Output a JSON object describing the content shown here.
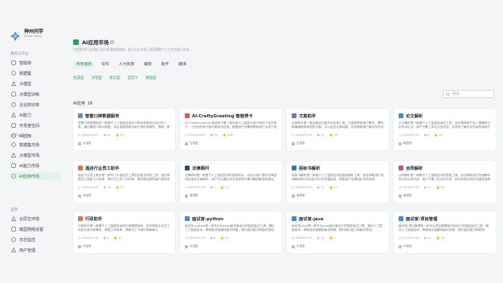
{
  "brand": {
    "name": "神州问学",
    "sub": "Smart Vision"
  },
  "sidebar": {
    "groups": [
      {
        "title": "我的工作台",
        "items": [
          "智能体",
          "数据集",
          "大模型",
          "大模型训练",
          "企业知识库",
          "AI能力",
          "开发者空间",
          "AI应用"
        ]
      },
      {
        "title": "问学AI市场",
        "items": [
          "数据集市场",
          "大模型市场",
          "AI能力市场",
          "AI应用市场"
        ]
      },
      {
        "title": "运营",
        "items": [
          "云原生环境",
          "模型网络设置",
          "日志监控",
          "用户管理"
        ]
      }
    ],
    "active": "AI应用市场"
  },
  "page": {
    "title": "AI应用市场",
    "subtitle": "为您提供行业内热门的AI应用和智能体，助可以从市场上直接提取个人工作台进行应用。",
    "tabs": [
      "所有类别",
      "写作",
      "人力资源",
      "编程",
      "助手",
      "翻译"
    ],
    "active_tab": "所有类别",
    "filters": [
      "生成型",
      "对话型",
      "语言型",
      "自定义",
      "增强型"
    ],
    "section_title": "AI应用",
    "section_count": "16",
    "search_placeholder": "搜索"
  },
  "colors": {
    "accent": "#27a35a"
  },
  "cards": [
    {
      "title": "智慧口岸数据服务",
      "icon_color": "#6c8ebf",
      "desc": "智慧口岸数据服务一款基于人工智能技术的口岸信息服务应用分析工具，通过集成口岸AI数据，该应用能帮助为用户提供准确的、透明、便捷服务。",
      "date": "2024/02/07",
      "views": "22",
      "likes": "10",
      "tag": "对话型"
    },
    {
      "title": "AI-CraftyGreeting 智能贺卡",
      "icon_color": "#e05555",
      "desc": "AI-CraftyGreeting 智能贺卡是一款利用人工智能为用户制作个性化贺卡，个性化的贺卡制作服务的应用，根据用户的需求帮助用户生成个性化。",
      "date": "2024/02/05",
      "views": "35",
      "likes": "108",
      "tag": "生成型"
    },
    {
      "title": "文案助手",
      "icon_color": "#8a6bd1",
      "desc": "文案助手是一款全面的文案写作应用工具。它能够帮助用户撰写、撰写和编辑各种类型的文案。可以给出文案标题、内容帮助用户解决写作问题。",
      "date": "2024/01/18",
      "views": "15",
      "likes": "99",
      "tag": "生成型"
    },
    {
      "title": "论文解析",
      "icon_color": "#3b8fd9",
      "desc": "论文解析是一款基于人工智能技术的工具，旨在帮助用户深入理解和分析学术论文。用户只需上传论文的内容，并提供了解论文内容的高效方式。",
      "date": "2024/01/19",
      "views": "6",
      "likes": "21",
      "tag": "增强型"
    },
    {
      "title": "酒店行业员工助手",
      "icon_color": "#e0713c",
      "desc": "酒店行业员工助手是一款专门为酒店员工提供全面支持的工具，旨在帮助员工提高工作效率，提升员工的工作效率，提供更优质的客户服务体验。",
      "date": "2024/01/19",
      "views": "16",
      "likes": "13",
      "tag": "对话型"
    },
    {
      "title": "法律顾问",
      "icon_color": "#2f4a73",
      "desc": "法律顾问是一款基于人工智能技术的智能助手，旨在为用户提供法律咨询及相关法律服务。用户可以通过本应用获得法律问题的解答和建议。",
      "date": "2024/01/19",
      "views": "7",
      "likes": "14",
      "tag": "增强型"
    },
    {
      "title": "招标书解析",
      "icon_color": "#2e6fd0",
      "desc": "招标书解析是一款基于人工智能技术的智能解析工具，旨在帮助用户快速解析和分析招标书中的关键信息，提高用户处理招标书的效率。",
      "date": "2024/01/19",
      "views": "13",
      "likes": "17",
      "tag": "增强型"
    },
    {
      "title": "合同解析",
      "icon_color": "#d04a8a",
      "desc": "合同解析是一款基于人工智能技术的智能工具，旨在帮助用户快速解析和分析合同内容，用户只需上传合同文档，即可获得合同的关键信息和风险提示。",
      "date": "2024/01/19",
      "views": "17",
      "likes": "81",
      "tag": "增强型"
    },
    {
      "title": "行政助手",
      "icon_color": "#e0713c",
      "desc": "行政助手是一款基于人工智能技术的行政管理系统，旨在帮助企业员工完成日常行政事务，提高工作效率，帮助员工节省时间和精力。",
      "date": "2024/01/19",
      "views": "1",
      "likes": "14",
      "tag": "对话型"
    },
    {
      "title": "面试官-python",
      "icon_color": "#3b8fd9",
      "desc": "面试官-python是一款专为Python面试者设计的智能面试工具。通过人工智能技术，帮助面试者模拟面试场景，提升面试能力和面试表现。",
      "date": "2024/01/19",
      "views": "8",
      "likes": "21",
      "tag": "对话型"
    },
    {
      "title": "面试官-java",
      "icon_color": "#3b8fd9",
      "desc": "面试官-java是一款专为Java面试者设计的智能面试工具。通过人工智能技术，帮助面试者模拟面试场景，提升面试能力和面试表现。",
      "date": "2024/01/19",
      "views": "12",
      "likes": "7",
      "tag": "对话型"
    },
    {
      "title": "面试官-项目管理",
      "icon_color": "#3b8fd9",
      "desc": "面试官-项目管理是一款专为项目管理面试者设计的智能面试工具。通过人工智能技术，帮助面试者模拟面试场景，提升面试能力和表现。",
      "date": "2024/01/19",
      "views": "14",
      "likes": "16",
      "tag": "对话型"
    }
  ]
}
